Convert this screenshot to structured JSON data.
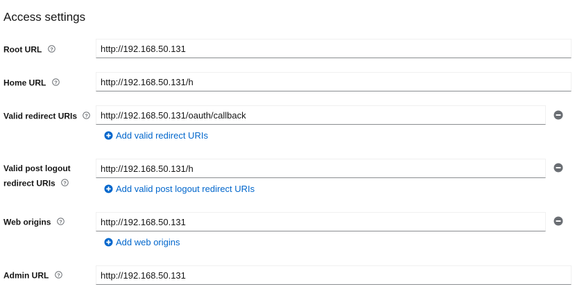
{
  "section": {
    "title": "Access settings"
  },
  "root_url": {
    "label": "Root URL",
    "value": "http://192.168.50.131"
  },
  "home_url": {
    "label": "Home URL",
    "value": "http://192.168.50.131/h"
  },
  "valid_redirect_uris": {
    "label": "Valid redirect URIs",
    "value": "http://192.168.50.131/oauth/callback",
    "add_label": "Add valid redirect URIs"
  },
  "valid_post_logout_redirect_uris": {
    "label_line1": "Valid post logout",
    "label_line2": "redirect URIs",
    "value": "http://192.168.50.131/h",
    "add_label": "Add valid post logout redirect URIs"
  },
  "web_origins": {
    "label": "Web origins",
    "value": "http://192.168.50.131",
    "add_label": "Add web origins"
  },
  "admin_url": {
    "label": "Admin URL",
    "value": "http://192.168.50.131"
  },
  "icons": {
    "help": "question-circle-icon",
    "remove": "minus-circle-icon",
    "add": "plus-circle-icon"
  },
  "colors": {
    "link": "#0066cc",
    "remove_icon": "#6a6e73",
    "input_border_bottom": "#8a8d90",
    "text": "#151515"
  }
}
